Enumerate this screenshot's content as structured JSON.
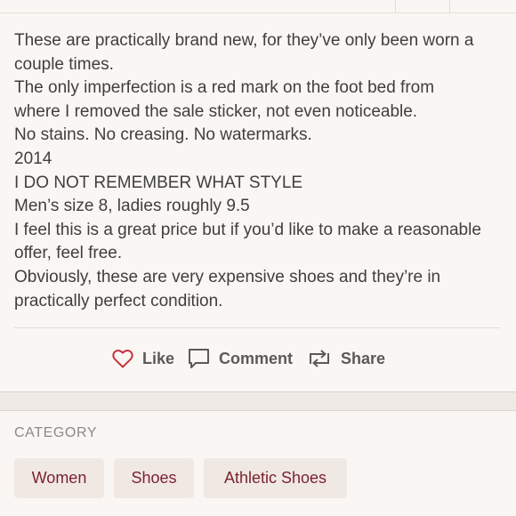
{
  "description": {
    "lines": [
      "These are practically brand new, for they’ve only been worn a",
      "couple times.",
      "The only imperfection is a red mark on the foot bed from",
      "where I removed the sale sticker, not even noticeable.",
      "No stains. No creasing. No watermarks.",
      "2014",
      "I DO NOT REMEMBER WHAT STYLE",
      "Men’s size 8, ladies roughly 9.5",
      "I feel this is a great price but if you’d like to make a reasonable",
      "offer, feel free.",
      "Obviously, these are very expensive shoes and they’re in",
      "practically perfect condition."
    ]
  },
  "social": {
    "like_label": "Like",
    "comment_label": "Comment",
    "share_label": "Share",
    "like_icon": "heart-icon",
    "comment_icon": "comment-bubble-icon",
    "share_icon": "share-repost-icon"
  },
  "category": {
    "title": "CATEGORY",
    "chips": [
      "Women",
      "Shoes",
      "Athletic Shoes"
    ]
  },
  "colors": {
    "accent": "#c4343f",
    "chip_text": "#7b2331",
    "chip_bg": "#f0e8e3",
    "background": "#faf6f3"
  }
}
